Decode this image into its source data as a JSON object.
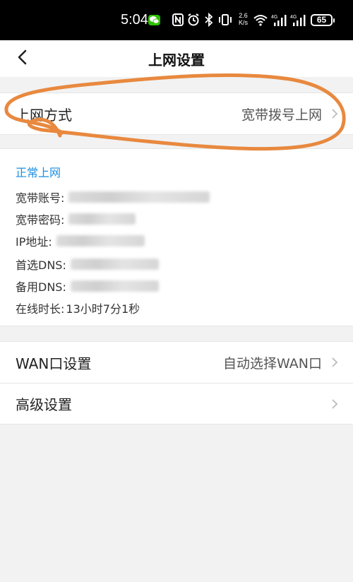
{
  "status_bar": {
    "time": "5:04",
    "net_speed_top": "2.6",
    "net_speed_bottom": "K/s",
    "battery": "65",
    "icons": [
      "wechat-icon",
      "nfc-icon",
      "alarm-icon",
      "bluetooth-icon",
      "vibrate-icon",
      "wifi-icon",
      "4g-signal-icon",
      "4g-signal-icon"
    ]
  },
  "header": {
    "title": "上网设置",
    "back_icon": "back-arrow-icon"
  },
  "connection": {
    "label": "上网方式",
    "value": "宽带拨号上网"
  },
  "status": {
    "title": "正常上网",
    "account_label": "宽带账号:",
    "account_value": "",
    "password_label": "宽带密码:",
    "password_value": "",
    "ip_label": "IP地址:",
    "ip_value": "",
    "dns1_label": "首选DNS:",
    "dns1_value": "",
    "dns2_label": "备用DNS:",
    "dns2_value": "",
    "online_label": "在线时长:",
    "online_value": "13小时7分1秒"
  },
  "wan": {
    "label": "WAN口设置",
    "value": "自动选择WAN口"
  },
  "advanced": {
    "label": "高级设置"
  },
  "colors": {
    "accent": "#1a8fe0",
    "annotation": "#e8893f",
    "background": "#f2f2f2"
  }
}
